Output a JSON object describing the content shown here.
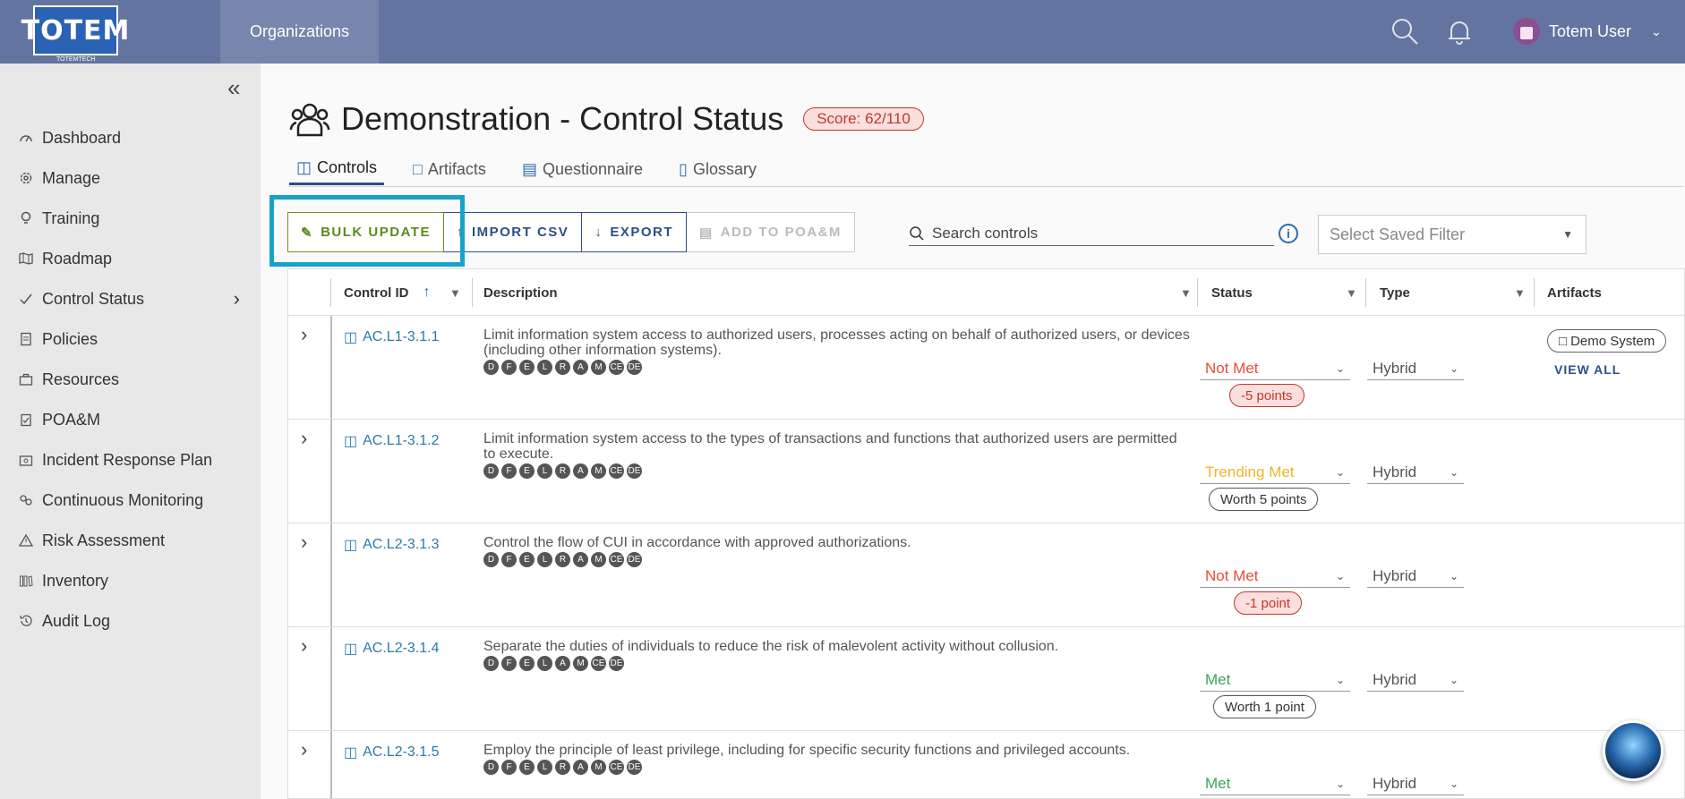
{
  "app": {
    "logo_text": "TOTEM",
    "logo_subtext": "TOTEMTECH",
    "nav_organizations": "Organizations",
    "user_name": "Totem User"
  },
  "sidebar": {
    "items": [
      {
        "label": "Dashboard",
        "icon": "dashboard-icon"
      },
      {
        "label": "Manage",
        "icon": "gear-icon"
      },
      {
        "label": "Training",
        "icon": "lightbulb-icon"
      },
      {
        "label": "Roadmap",
        "icon": "map-icon"
      },
      {
        "label": "Control Status",
        "icon": "check-icon"
      },
      {
        "label": "Policies",
        "icon": "document-icon"
      },
      {
        "label": "Resources",
        "icon": "briefcase-icon"
      },
      {
        "label": "POA&M",
        "icon": "clipboard-icon"
      },
      {
        "label": "Incident Response Plan",
        "icon": "folder-icon"
      },
      {
        "label": "Continuous Monitoring",
        "icon": "monitoring-icon"
      },
      {
        "label": "Risk Assessment",
        "icon": "warning-icon"
      },
      {
        "label": "Inventory",
        "icon": "inventory-icon"
      },
      {
        "label": "Audit Log",
        "icon": "history-icon"
      }
    ]
  },
  "page": {
    "title": "Demonstration - Control Status",
    "score": "Score: 62/110",
    "tabs": [
      {
        "label": "Controls"
      },
      {
        "label": "Artifacts"
      },
      {
        "label": "Questionnaire"
      },
      {
        "label": "Glossary"
      }
    ]
  },
  "toolbar": {
    "bulk_update": "BULK UPDATE",
    "import_csv": "IMPORT CSV",
    "export": "EXPORT",
    "add_to_poam": "ADD TO POA&M",
    "search_placeholder": "Search controls",
    "saved_filter_placeholder": "Select Saved Filter"
  },
  "table": {
    "headers": {
      "control_id": "Control ID",
      "description": "Description",
      "status": "Status",
      "type": "Type",
      "artifacts": "Artifacts"
    },
    "rows": [
      {
        "id": "AC.L1-3.1.1",
        "description": "Limit information system access to authorized users, processes acting on behalf of authorized users, or devices (including other information systems).",
        "badges": [
          "D",
          "F",
          "E",
          "L",
          "R",
          "A",
          "M",
          "CE",
          "DE"
        ],
        "status": "Not Met",
        "status_color": "#e74c3c",
        "points": "-5 points",
        "points_kind": "neg",
        "type": "Hybrid",
        "artifact": "Demo System",
        "view_all": "VIEW ALL"
      },
      {
        "id": "AC.L1-3.1.2",
        "description": "Limit information system access to the types of transactions and functions that authorized users are permitted to execute.",
        "badges": [
          "D",
          "F",
          "E",
          "L",
          "R",
          "A",
          "M",
          "CE",
          "DE"
        ],
        "status": "Trending Met",
        "status_color": "#f0b429",
        "points": "Worth 5 points",
        "points_kind": "pos",
        "type": "Hybrid"
      },
      {
        "id": "AC.L2-3.1.3",
        "description": "Control the flow of CUI in accordance with approved authorizations.",
        "badges": [
          "D",
          "F",
          "E",
          "L",
          "R",
          "A",
          "M",
          "CE",
          "DE"
        ],
        "status": "Not Met",
        "status_color": "#e74c3c",
        "points": "-1 point",
        "points_kind": "neg",
        "type": "Hybrid"
      },
      {
        "id": "AC.L2-3.1.4",
        "description": "Separate the duties of individuals to reduce the risk of malevolent activity without collusion.",
        "badges": [
          "D",
          "F",
          "E",
          "L",
          "A",
          "M",
          "CE",
          "DE"
        ],
        "status": "Met",
        "status_color": "#3aa55a",
        "points": "Worth 1 point",
        "points_kind": "pos",
        "type": "Hybrid"
      },
      {
        "id": "AC.L2-3.1.5",
        "description": "Employ the principle of least privilege, including for specific security functions and privileged accounts.",
        "badges": [
          "D",
          "F",
          "E",
          "L",
          "R",
          "A",
          "M",
          "CE",
          "DE"
        ],
        "status": "Met",
        "status_color": "#3aa55a",
        "type": "Hybrid"
      }
    ]
  }
}
